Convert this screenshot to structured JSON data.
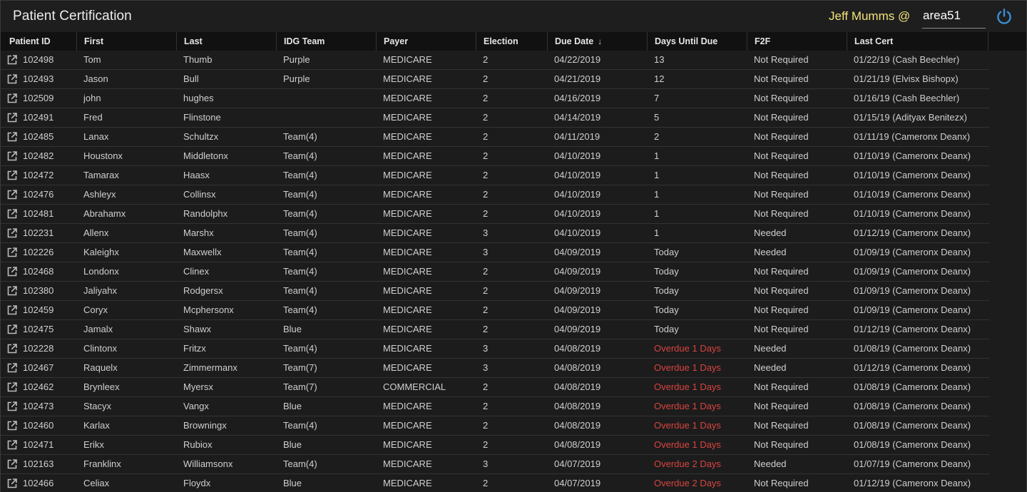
{
  "header": {
    "title": "Patient Certification",
    "user": "Jeff Mumms @",
    "facility": "area51",
    "power_icon": "power-icon"
  },
  "colors": {
    "overdue": "#d8443f",
    "user_name": "#f2e27a",
    "power": "#3b8fd9"
  },
  "columns": [
    {
      "key": "id",
      "label": "Patient ID"
    },
    {
      "key": "first",
      "label": "First"
    },
    {
      "key": "last",
      "label": "Last"
    },
    {
      "key": "team",
      "label": "IDG Team"
    },
    {
      "key": "payer",
      "label": "Payer"
    },
    {
      "key": "election",
      "label": "Election"
    },
    {
      "key": "due",
      "label": "Due Date",
      "sort": "↓"
    },
    {
      "key": "days",
      "label": "Days Until Due"
    },
    {
      "key": "f2f",
      "label": "F2F"
    },
    {
      "key": "cert",
      "label": "Last Cert"
    }
  ],
  "rows": [
    {
      "id": "102498",
      "first": "Tom",
      "last": "Thumb",
      "team": "Purple",
      "payer": "MEDICARE",
      "election": "2",
      "due": "04/22/2019",
      "days": "13",
      "f2f": "Not Required",
      "cert": "01/22/19 (Cash Beechler)"
    },
    {
      "id": "102493",
      "first": "Jason",
      "last": "Bull",
      "team": "Purple",
      "payer": "MEDICARE",
      "election": "2",
      "due": "04/21/2019",
      "days": "12",
      "f2f": "Not Required",
      "cert": "01/21/19 (Elvisx Bishopx)"
    },
    {
      "id": "102509",
      "first": "john",
      "last": "hughes",
      "team": "",
      "payer": "MEDICARE",
      "election": "2",
      "due": "04/16/2019",
      "days": "7",
      "f2f": "Not Required",
      "cert": "01/16/19 (Cash Beechler)"
    },
    {
      "id": "102491",
      "first": "Fred",
      "last": "Flinstone",
      "team": "",
      "payer": "MEDICARE",
      "election": "2",
      "due": "04/14/2019",
      "days": "5",
      "f2f": "Not Required",
      "cert": "01/15/19 (Adityax Benitezx)"
    },
    {
      "id": "102485",
      "first": "Lanax",
      "last": "Schultzx",
      "team": "Team(4)",
      "payer": "MEDICARE",
      "election": "2",
      "due": "04/11/2019",
      "days": "2",
      "f2f": "Not Required",
      "cert": "01/11/19 (Cameronx Deanx)"
    },
    {
      "id": "102482",
      "first": "Houstonx",
      "last": "Middletonx",
      "team": "Team(4)",
      "payer": "MEDICARE",
      "election": "2",
      "due": "04/10/2019",
      "days": "1",
      "f2f": "Not Required",
      "cert": "01/10/19 (Cameronx Deanx)"
    },
    {
      "id": "102472",
      "first": "Tamarax",
      "last": "Haasx",
      "team": "Team(4)",
      "payer": "MEDICARE",
      "election": "2",
      "due": "04/10/2019",
      "days": "1",
      "f2f": "Not Required",
      "cert": "01/10/19 (Cameronx Deanx)"
    },
    {
      "id": "102476",
      "first": "Ashleyx",
      "last": "Collinsx",
      "team": "Team(4)",
      "payer": "MEDICARE",
      "election": "2",
      "due": "04/10/2019",
      "days": "1",
      "f2f": "Not Required",
      "cert": "01/10/19 (Cameronx Deanx)"
    },
    {
      "id": "102481",
      "first": "Abrahamx",
      "last": "Randolphx",
      "team": "Team(4)",
      "payer": "MEDICARE",
      "election": "2",
      "due": "04/10/2019",
      "days": "1",
      "f2f": "Not Required",
      "cert": "01/10/19 (Cameronx Deanx)"
    },
    {
      "id": "102231",
      "first": "Allenx",
      "last": "Marshx",
      "team": "Team(4)",
      "payer": "MEDICARE",
      "election": "3",
      "due": "04/10/2019",
      "days": "1",
      "f2f": "Needed",
      "cert": "01/12/19 (Cameronx Deanx)"
    },
    {
      "id": "102226",
      "first": "Kaleighx",
      "last": "Maxwellx",
      "team": "Team(4)",
      "payer": "MEDICARE",
      "election": "3",
      "due": "04/09/2019",
      "days": "Today",
      "f2f": "Needed",
      "cert": "01/09/19 (Cameronx Deanx)"
    },
    {
      "id": "102468",
      "first": "Londonx",
      "last": "Clinex",
      "team": "Team(4)",
      "payer": "MEDICARE",
      "election": "2",
      "due": "04/09/2019",
      "days": "Today",
      "f2f": "Not Required",
      "cert": "01/09/19 (Cameronx Deanx)"
    },
    {
      "id": "102380",
      "first": "Jaliyahx",
      "last": "Rodgersx",
      "team": "Team(4)",
      "payer": "MEDICARE",
      "election": "2",
      "due": "04/09/2019",
      "days": "Today",
      "f2f": "Not Required",
      "cert": "01/09/19 (Cameronx Deanx)"
    },
    {
      "id": "102459",
      "first": "Coryx",
      "last": "Mcphersonx",
      "team": "Team(4)",
      "payer": "MEDICARE",
      "election": "2",
      "due": "04/09/2019",
      "days": "Today",
      "f2f": "Not Required",
      "cert": "01/09/19 (Cameronx Deanx)"
    },
    {
      "id": "102475",
      "first": "Jamalx",
      "last": "Shawx",
      "team": "Blue",
      "payer": "MEDICARE",
      "election": "2",
      "due": "04/09/2019",
      "days": "Today",
      "f2f": "Not Required",
      "cert": "01/12/19 (Cameronx Deanx)"
    },
    {
      "id": "102228",
      "first": "Clintonx",
      "last": "Fritzx",
      "team": "Team(4)",
      "payer": "MEDICARE",
      "election": "3",
      "due": "04/08/2019",
      "days": "Overdue 1 Days",
      "overdue": true,
      "f2f": "Needed",
      "cert": "01/08/19 (Cameronx Deanx)"
    },
    {
      "id": "102467",
      "first": "Raquelx",
      "last": "Zimmermanx",
      "team": "Team(7)",
      "payer": "MEDICARE",
      "election": "3",
      "due": "04/08/2019",
      "days": "Overdue 1 Days",
      "overdue": true,
      "f2f": "Needed",
      "cert": "01/12/19 (Cameronx Deanx)"
    },
    {
      "id": "102462",
      "first": "Brynleex",
      "last": "Myersx",
      "team": "Team(7)",
      "payer": "COMMERCIAL",
      "election": "2",
      "due": "04/08/2019",
      "days": "Overdue 1 Days",
      "overdue": true,
      "f2f": "Not Required",
      "cert": "01/08/19 (Cameronx Deanx)"
    },
    {
      "id": "102473",
      "first": "Stacyx",
      "last": "Vangx",
      "team": "Blue",
      "payer": "MEDICARE",
      "election": "2",
      "due": "04/08/2019",
      "days": "Overdue 1 Days",
      "overdue": true,
      "f2f": "Not Required",
      "cert": "01/08/19 (Cameronx Deanx)"
    },
    {
      "id": "102460",
      "first": "Karlax",
      "last": "Browningx",
      "team": "Team(4)",
      "payer": "MEDICARE",
      "election": "2",
      "due": "04/08/2019",
      "days": "Overdue 1 Days",
      "overdue": true,
      "f2f": "Not Required",
      "cert": "01/08/19 (Cameronx Deanx)"
    },
    {
      "id": "102471",
      "first": "Erikx",
      "last": "Rubiox",
      "team": "Blue",
      "payer": "MEDICARE",
      "election": "2",
      "due": "04/08/2019",
      "days": "Overdue 1 Days",
      "overdue": true,
      "f2f": "Not Required",
      "cert": "01/08/19 (Cameronx Deanx)"
    },
    {
      "id": "102163",
      "first": "Franklinx",
      "last": "Williamsonx",
      "team": "Team(4)",
      "payer": "MEDICARE",
      "election": "3",
      "due": "04/07/2019",
      "days": "Overdue 2 Days",
      "overdue": true,
      "f2f": "Needed",
      "cert": "01/07/19 (Cameronx Deanx)"
    },
    {
      "id": "102466",
      "first": "Celiax",
      "last": "Floydx",
      "team": "Blue",
      "payer": "MEDICARE",
      "election": "2",
      "due": "04/07/2019",
      "days": "Overdue 2 Days",
      "overdue": true,
      "f2f": "Not Required",
      "cert": "01/12/19 (Cameronx Deanx)"
    }
  ]
}
